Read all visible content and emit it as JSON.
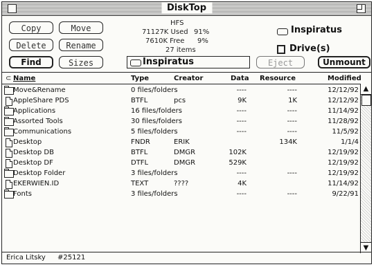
{
  "window": {
    "title": "DiskTop"
  },
  "buttons": {
    "copy": "Copy",
    "move": "Move",
    "delete": "Delete",
    "rename": "Rename",
    "find": "Find",
    "sizes": "Sizes",
    "eject": "Eject",
    "unmount": "Unmount"
  },
  "volume": {
    "format": "HFS",
    "used_amount": "71127K Used",
    "used_pct": "91%",
    "free_amount": "7610K Free",
    "free_pct": "9%",
    "items": "27 items",
    "name": "Inspiratus",
    "drive_label": "Drive(s)",
    "path": "Inspiratus"
  },
  "columns": {
    "name": "Name",
    "type": "Type",
    "creator": "Creator",
    "data": "Data",
    "resource": "Resource",
    "modified": "Modified"
  },
  "rows": [
    {
      "name": "Move&Rename",
      "type": "0 files/folders",
      "creator": "",
      "data": "----",
      "resource": "----",
      "modified": "12/12/92",
      "icon": "folder-icon"
    },
    {
      "name": "AppleShare PDS",
      "type": "BTFL",
      "creator": "pcs",
      "data": "9K",
      "resource": "1K",
      "modified": "12/12/92",
      "icon": "document-icon"
    },
    {
      "name": "Applications",
      "type": "16 files/folders",
      "creator": "",
      "data": "----",
      "resource": "----",
      "modified": "11/14/92",
      "icon": "folder-icon"
    },
    {
      "name": "Assorted Tools",
      "type": "30 files/folders",
      "creator": "",
      "data": "----",
      "resource": "----",
      "modified": "11/28/92",
      "icon": "folder-icon"
    },
    {
      "name": "Communications",
      "type": "5 files/folders",
      "creator": "",
      "data": "----",
      "resource": "----",
      "modified": "11/5/92",
      "icon": "folder-icon"
    },
    {
      "name": "Desktop",
      "type": "FNDR",
      "creator": "ERIK",
      "data": "",
      "resource": "134K",
      "modified": "1/1/4",
      "icon": "document-icon"
    },
    {
      "name": "Desktop DB",
      "type": "BTFL",
      "creator": "DMGR",
      "data": "102K",
      "resource": "",
      "modified": "12/19/92",
      "icon": "document-icon"
    },
    {
      "name": "Desktop DF",
      "type": "DTFL",
      "creator": "DMGR",
      "data": "529K",
      "resource": "",
      "modified": "12/19/92",
      "icon": "document-icon"
    },
    {
      "name": "Desktop Folder",
      "type": "3 files/folders",
      "creator": "",
      "data": "----",
      "resource": "----",
      "modified": "12/19/92",
      "icon": "folder-icon"
    },
    {
      "name": "EKERWIEN.ID",
      "type": "TEXT",
      "creator": "????",
      "data": "4K",
      "resource": "",
      "modified": "11/14/92",
      "icon": "document-icon"
    },
    {
      "name": "Fonts",
      "type": "3 files/folders",
      "creator": "",
      "data": "----",
      "resource": "----",
      "modified": "9/22/91",
      "icon": "folder-icon"
    }
  ],
  "status": {
    "user": "Erica Litsky",
    "id": "#25121"
  }
}
